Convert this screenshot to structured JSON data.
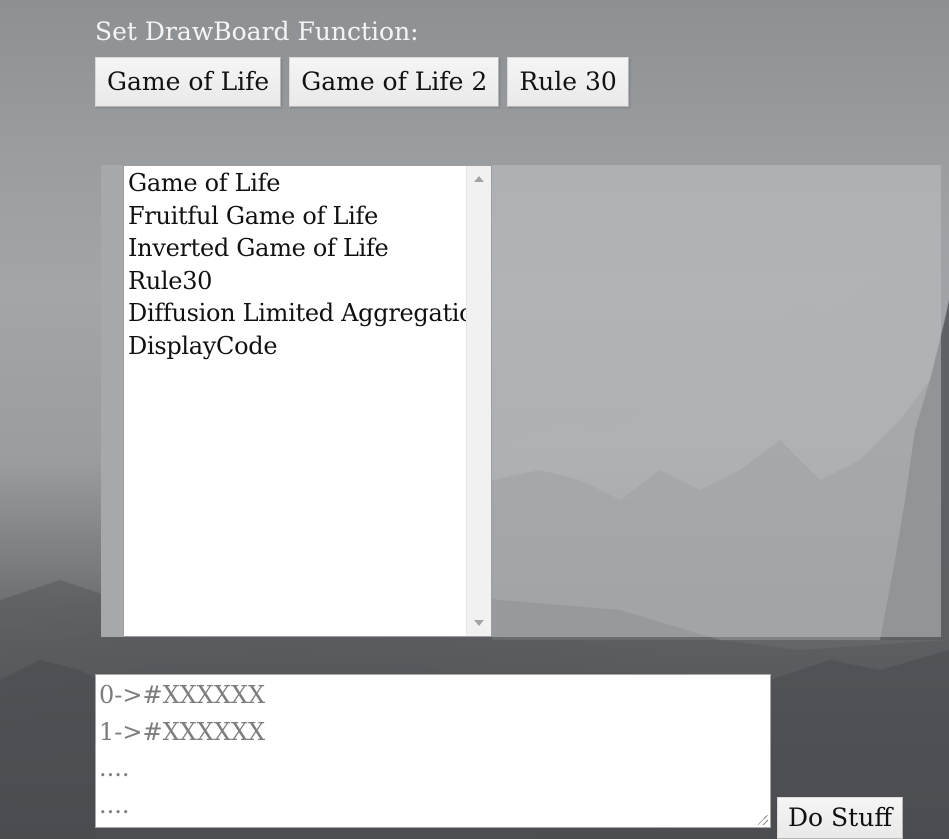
{
  "header": {
    "title": "Set DrawBoard Function:"
  },
  "function_buttons": [
    {
      "label": "Game of Life"
    },
    {
      "label": "Game of Life 2"
    },
    {
      "label": "Rule 30"
    }
  ],
  "function_list": {
    "items": [
      "Game of Life",
      "Fruitful Game of Life",
      "Inverted Game of Life",
      "Rule30",
      "Diffusion Limited Aggregation",
      "DisplayCode"
    ]
  },
  "color_input": {
    "placeholder": "0->#XXXXXX\n1->#XXXXXX\n....\n...."
  },
  "action_button": {
    "label": "Do Stuff"
  },
  "icons": {
    "scroll_up": "chevron-up-icon",
    "scroll_down": "chevron-down-icon",
    "resize": "resize-grip-icon"
  }
}
